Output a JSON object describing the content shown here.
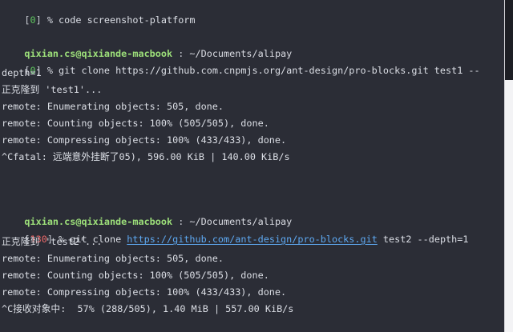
{
  "terminal": {
    "line1": {
      "code": "0",
      "command": " % code screenshot-platform"
    },
    "prompt1": {
      "user": "qixian.cs@qixiande-macbook",
      "separator": " : ",
      "path": "~/Documents/alipay"
    },
    "line3": {
      "code": "0",
      "command": " % git clone https://github.com.cnpmjs.org/ant-design/pro-blocks.git test1 --"
    },
    "line4": "depth=1",
    "clone1_output": [
      "正克隆到 'test1'...",
      "remote: Enumerating objects: 505, done.",
      "remote: Counting objects: 100% (505/505), done.",
      "remote: Compressing objects: 100% (433/433), done.",
      "^Cfatal: 远端意外挂断了05), 596.00 KiB | 140.00 KiB/s"
    ],
    "prompt2": {
      "user": "qixian.cs@qixiande-macbook",
      "separator": " : ",
      "path": "~/Documents/alipay"
    },
    "line11": {
      "code": "130",
      "pre": " % git clone ",
      "url": "https://github.com/ant-design/pro-blocks.git",
      "post": " test2 --depth=1"
    },
    "clone2_output": [
      "正克隆到 'test2'...",
      "remote: Enumerating objects: 505, done.",
      "remote: Counting objects: 100% (505/505), done.",
      "remote: Compressing objects: 100% (433/433), done.",
      "^C接收对象中:  57% (288/505), 1.40 MiB | 557.00 KiB/s"
    ]
  },
  "colors": {
    "background": "#2b2d36",
    "success_code": "#5fc75f",
    "error_code": "#f06a6a",
    "prompt_user": "#9de07a",
    "link": "#5ea9f2"
  }
}
